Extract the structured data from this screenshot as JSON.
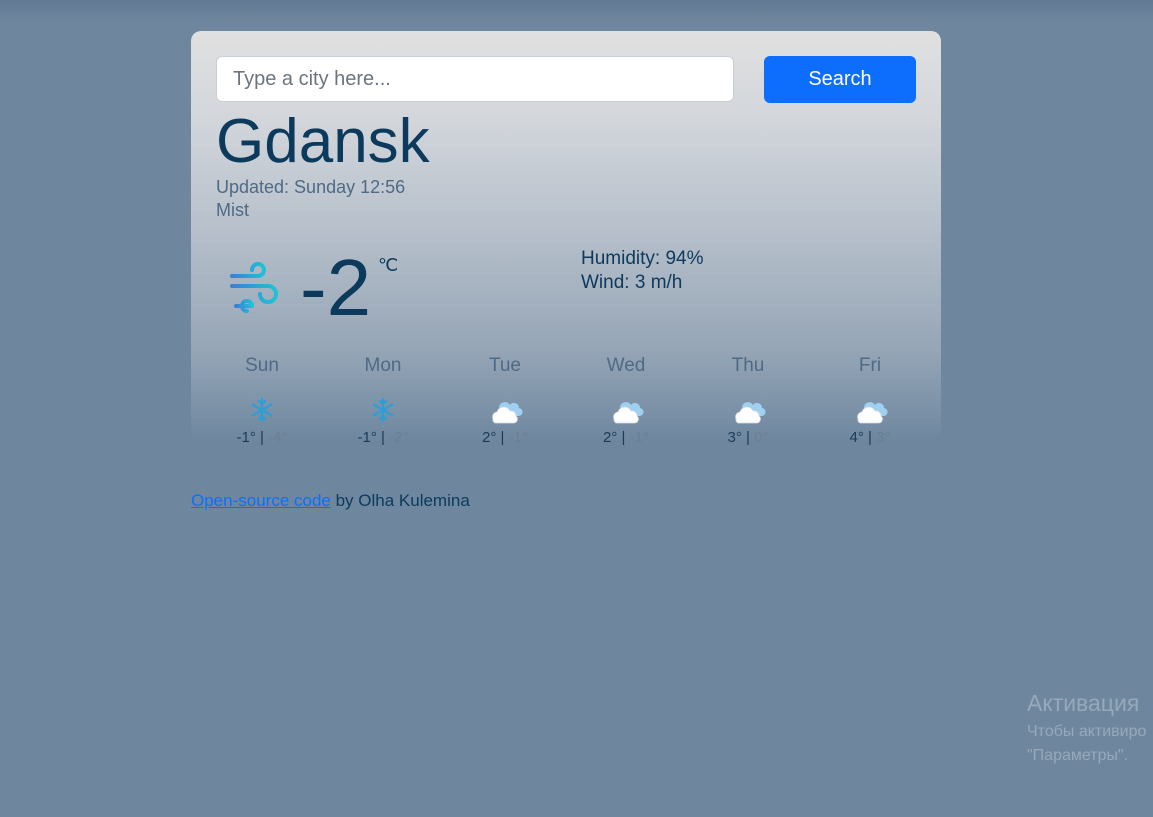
{
  "search": {
    "placeholder": "Type a city here...",
    "button_label": "Search"
  },
  "current": {
    "city": "Gdansk",
    "updated": "Updated: Sunday 12:56",
    "description": "Mist",
    "icon": "wind-icon",
    "temperature": "-2",
    "unit": "℃",
    "humidity": "Humidity: 94%",
    "wind": "Wind: 3 m/h"
  },
  "forecast": [
    {
      "day": "Sun",
      "icon": "snowflake-icon",
      "max": "-1°",
      "sep": " | ",
      "min": "-4°"
    },
    {
      "day": "Mon",
      "icon": "snowflake-icon",
      "max": "-1°",
      "sep": " | ",
      "min": "-2°"
    },
    {
      "day": "Tue",
      "icon": "cloud-icon",
      "max": "2°",
      "sep": " | ",
      "min": "-1°"
    },
    {
      "day": "Wed",
      "icon": "cloud-icon",
      "max": "2°",
      "sep": " | ",
      "min": "-1°"
    },
    {
      "day": "Thu",
      "icon": "cloud-icon",
      "max": "3°",
      "sep": " | ",
      "min": "0°"
    },
    {
      "day": "Fri",
      "icon": "cloud-icon",
      "max": "4°",
      "sep": " | ",
      "min": "3°"
    }
  ],
  "footer": {
    "link_text": "Open-source code",
    "credit": " by Olha Kulemina"
  },
  "windows_activation": {
    "title": "Активация",
    "line1": "Чтобы активиро",
    "line2": "\"Параметры\"."
  },
  "colors": {
    "background": "#6e879f",
    "accent": "#0d6efd",
    "text_dark": "#0b3a5c"
  }
}
